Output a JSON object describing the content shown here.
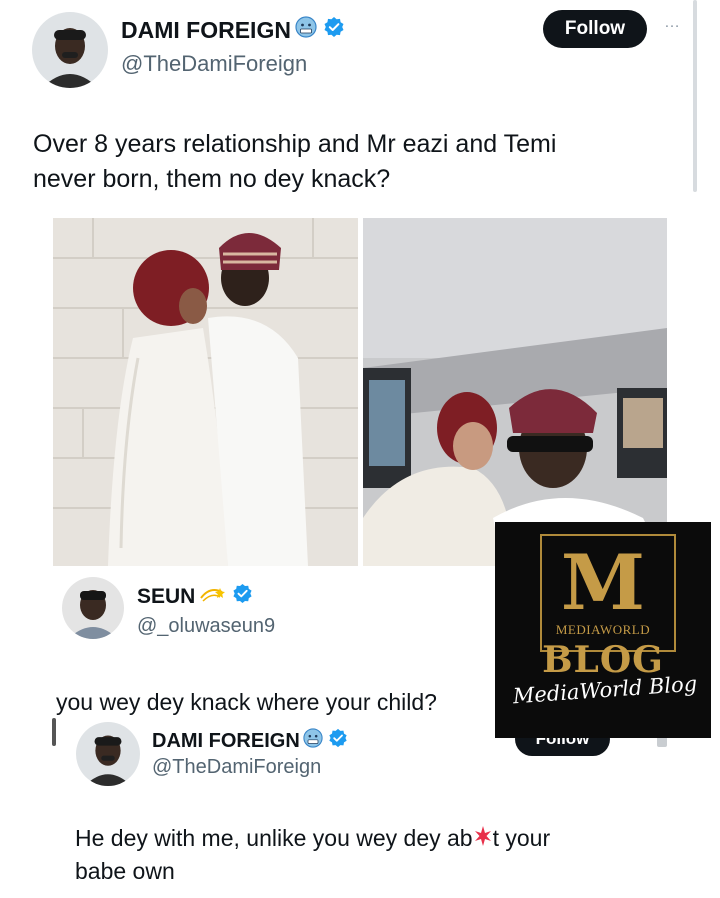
{
  "main_tweet": {
    "display_name": "DAMI FOREIGN",
    "handle": "@TheDamiForeign",
    "follow_label": "Follow",
    "more_label": "…",
    "text_line1": "Over 8 years relationship and Mr eazi and Temi",
    "text_line2": "never born, them no dey knack?"
  },
  "reply_tweet": {
    "display_name": "SEUN",
    "handle": "@_oluwaseun9",
    "text": "you wey dey knack where your child?"
  },
  "response_tweet": {
    "display_name": "DAMI FOREIGN",
    "handle": "@TheDamiForeign",
    "follow_label": "Follow",
    "text_line1": "He dey with me, unlike you wey dey ab",
    "text_line1_end": "t your",
    "text_line2": "babe own"
  },
  "watermark": {
    "letter": "M",
    "line1": "MEDIAWORLD",
    "line2": "BLOG",
    "script": "MediaWorld Blog"
  },
  "colors": {
    "text": "#0f1419",
    "secondary": "#536471",
    "verified": "#1d9bf0",
    "follow_bg": "#0f1419",
    "watermark_gold": "#c59b47"
  }
}
